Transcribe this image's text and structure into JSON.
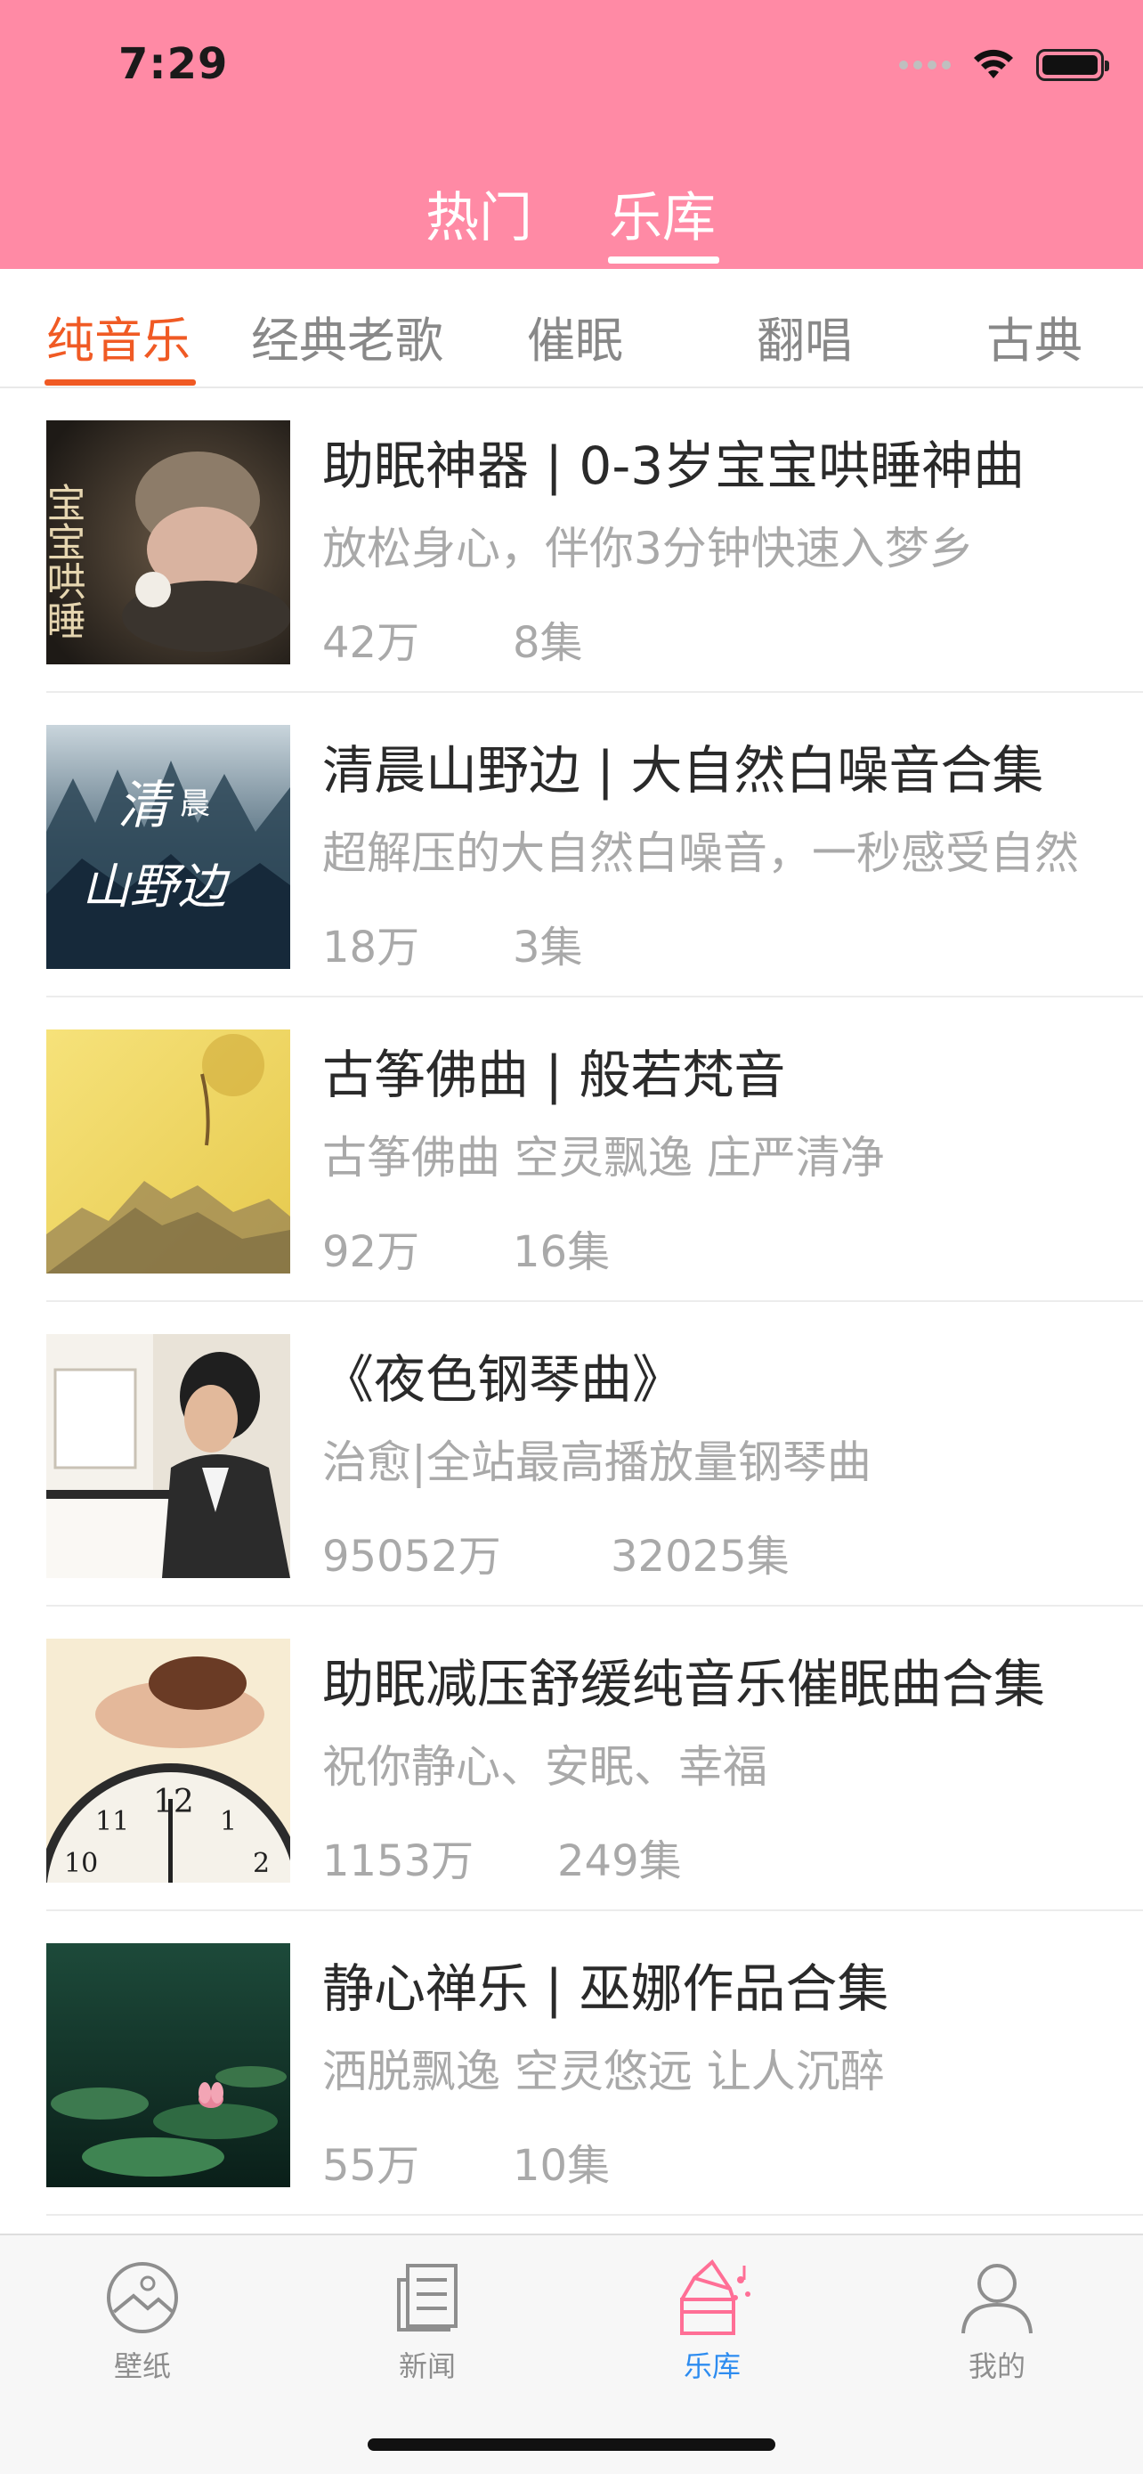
{
  "status_bar": {
    "time": "7:29"
  },
  "top_tabs": [
    {
      "label": "热门"
    },
    {
      "label": "乐库"
    }
  ],
  "category_tabs": [
    {
      "label": "纯音乐"
    },
    {
      "label": "经典老歌"
    },
    {
      "label": "催眠"
    },
    {
      "label": "翻唱"
    },
    {
      "label": "古典"
    }
  ],
  "albums": [
    {
      "title": "助眠神器 | 0-3岁宝宝哄睡神曲",
      "subtitle": "放松身心，伴你3分钟快速入梦乡",
      "plays": "42万",
      "episodes": "8集",
      "cover_text": "宝宝哄睡"
    },
    {
      "title": "清晨山野边 | 大自然白噪音合集",
      "subtitle": "超解压的大自然白噪音，一秒感受自然",
      "plays": "18万",
      "episodes": "3集",
      "cover_text": "清晨山野边"
    },
    {
      "title": "古筝佛曲 | 般若梵音",
      "subtitle": "古筝佛曲 空灵飘逸 庄严清净",
      "plays": "92万",
      "episodes": "16集",
      "cover_text": ""
    },
    {
      "title": "《夜色钢琴曲》",
      "subtitle": "治愈|全站最高播放量钢琴曲",
      "plays": "95052万",
      "episodes": "32025集",
      "cover_text": ""
    },
    {
      "title": "助眠减压舒缓纯音乐催眠曲合集",
      "subtitle": "祝你静心、安眠、幸福",
      "plays": "1153万",
      "episodes": "249集",
      "cover_text": ""
    },
    {
      "title": "静心禅乐 | 巫娜作品合集",
      "subtitle": "洒脱飘逸 空灵悠远 让人沉醉",
      "plays": "55万",
      "episodes": "10集",
      "cover_text": ""
    }
  ],
  "bottom_tabs": [
    {
      "label": "壁纸",
      "icon": "wallpaper-icon"
    },
    {
      "label": "新闻",
      "icon": "news-icon"
    },
    {
      "label": "乐库",
      "icon": "music-library-icon"
    },
    {
      "label": "我的",
      "icon": "profile-icon"
    }
  ],
  "colors": {
    "header_bg": "#ff8aa5",
    "accent_orange": "#f05a24",
    "active_tab_blue": "#2d8cf0"
  }
}
